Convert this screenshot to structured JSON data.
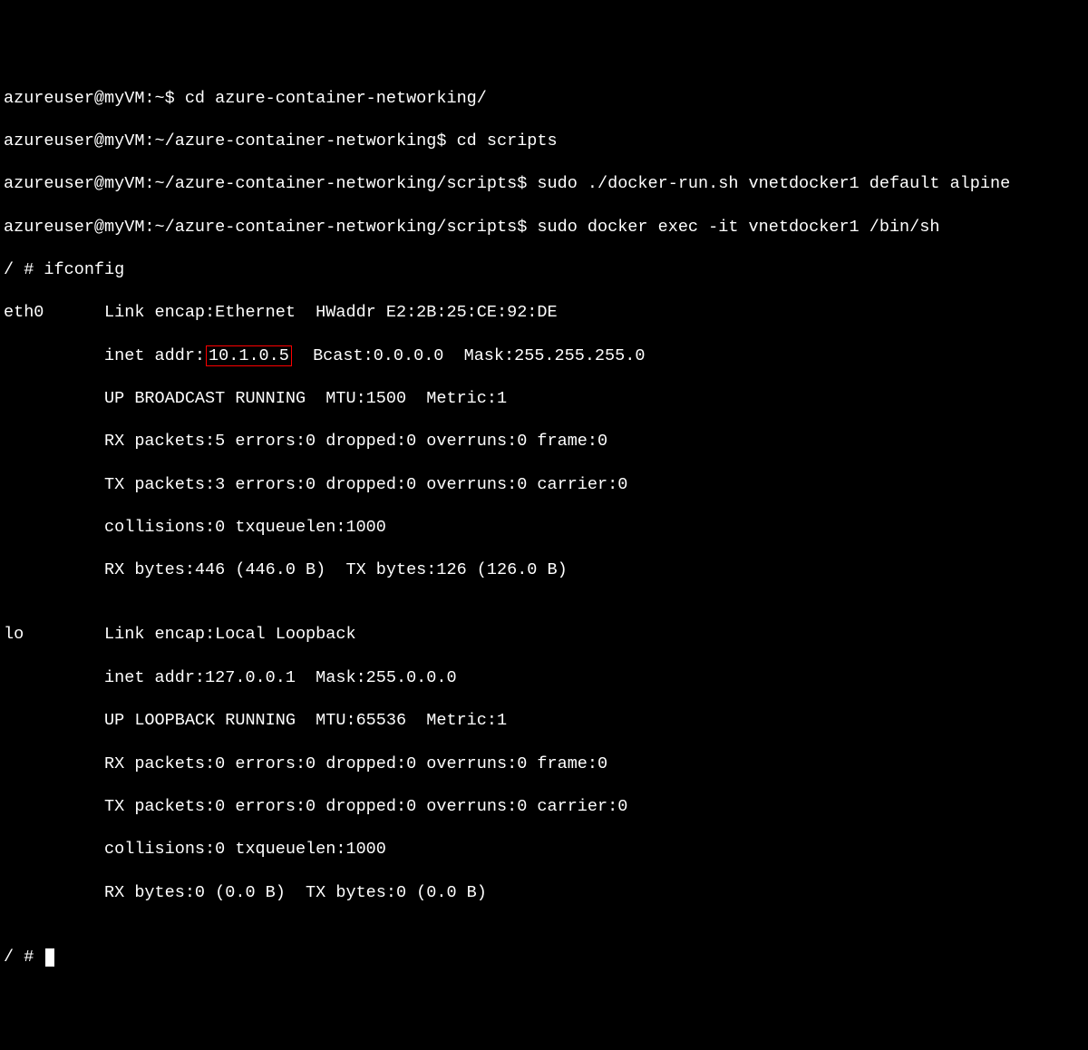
{
  "lines": {
    "l1": "azureuser@myVM:~$ cd azure-container-networking/",
    "l2": "azureuser@myVM:~/azure-container-networking$ cd scripts",
    "l3": "azureuser@myVM:~/azure-container-networking/scripts$ sudo ./docker-run.sh vnetdocker1 default alpine",
    "l4": "azureuser@myVM:~/azure-container-networking/scripts$ sudo docker exec -it vnetdocker1 /bin/sh",
    "l5": "/ # ifconfig",
    "l6": "eth0      Link encap:Ethernet  HWaddr E2:2B:25:CE:92:DE",
    "l7a": "          inet addr:",
    "l7_highlight": "10.1.0.5",
    "l7b": "  Bcast:0.0.0.0  Mask:255.255.255.0",
    "l8": "          UP BROADCAST RUNNING  MTU:1500  Metric:1",
    "l9": "          RX packets:5 errors:0 dropped:0 overruns:0 frame:0",
    "l10": "          TX packets:3 errors:0 dropped:0 overruns:0 carrier:0",
    "l11": "          collisions:0 txqueuelen:1000",
    "l12": "          RX bytes:446 (446.0 B)  TX bytes:126 (126.0 B)",
    "l13": "",
    "l14": "lo        Link encap:Local Loopback",
    "l15": "          inet addr:127.0.0.1  Mask:255.0.0.0",
    "l16": "          UP LOOPBACK RUNNING  MTU:65536  Metric:1",
    "l17": "          RX packets:0 errors:0 dropped:0 overruns:0 frame:0",
    "l18": "          TX packets:0 errors:0 dropped:0 overruns:0 carrier:0",
    "l19": "          collisions:0 txqueuelen:1000",
    "l20": "          RX bytes:0 (0.0 B)  TX bytes:0 (0.0 B)",
    "l21": "",
    "l22": "/ # "
  }
}
